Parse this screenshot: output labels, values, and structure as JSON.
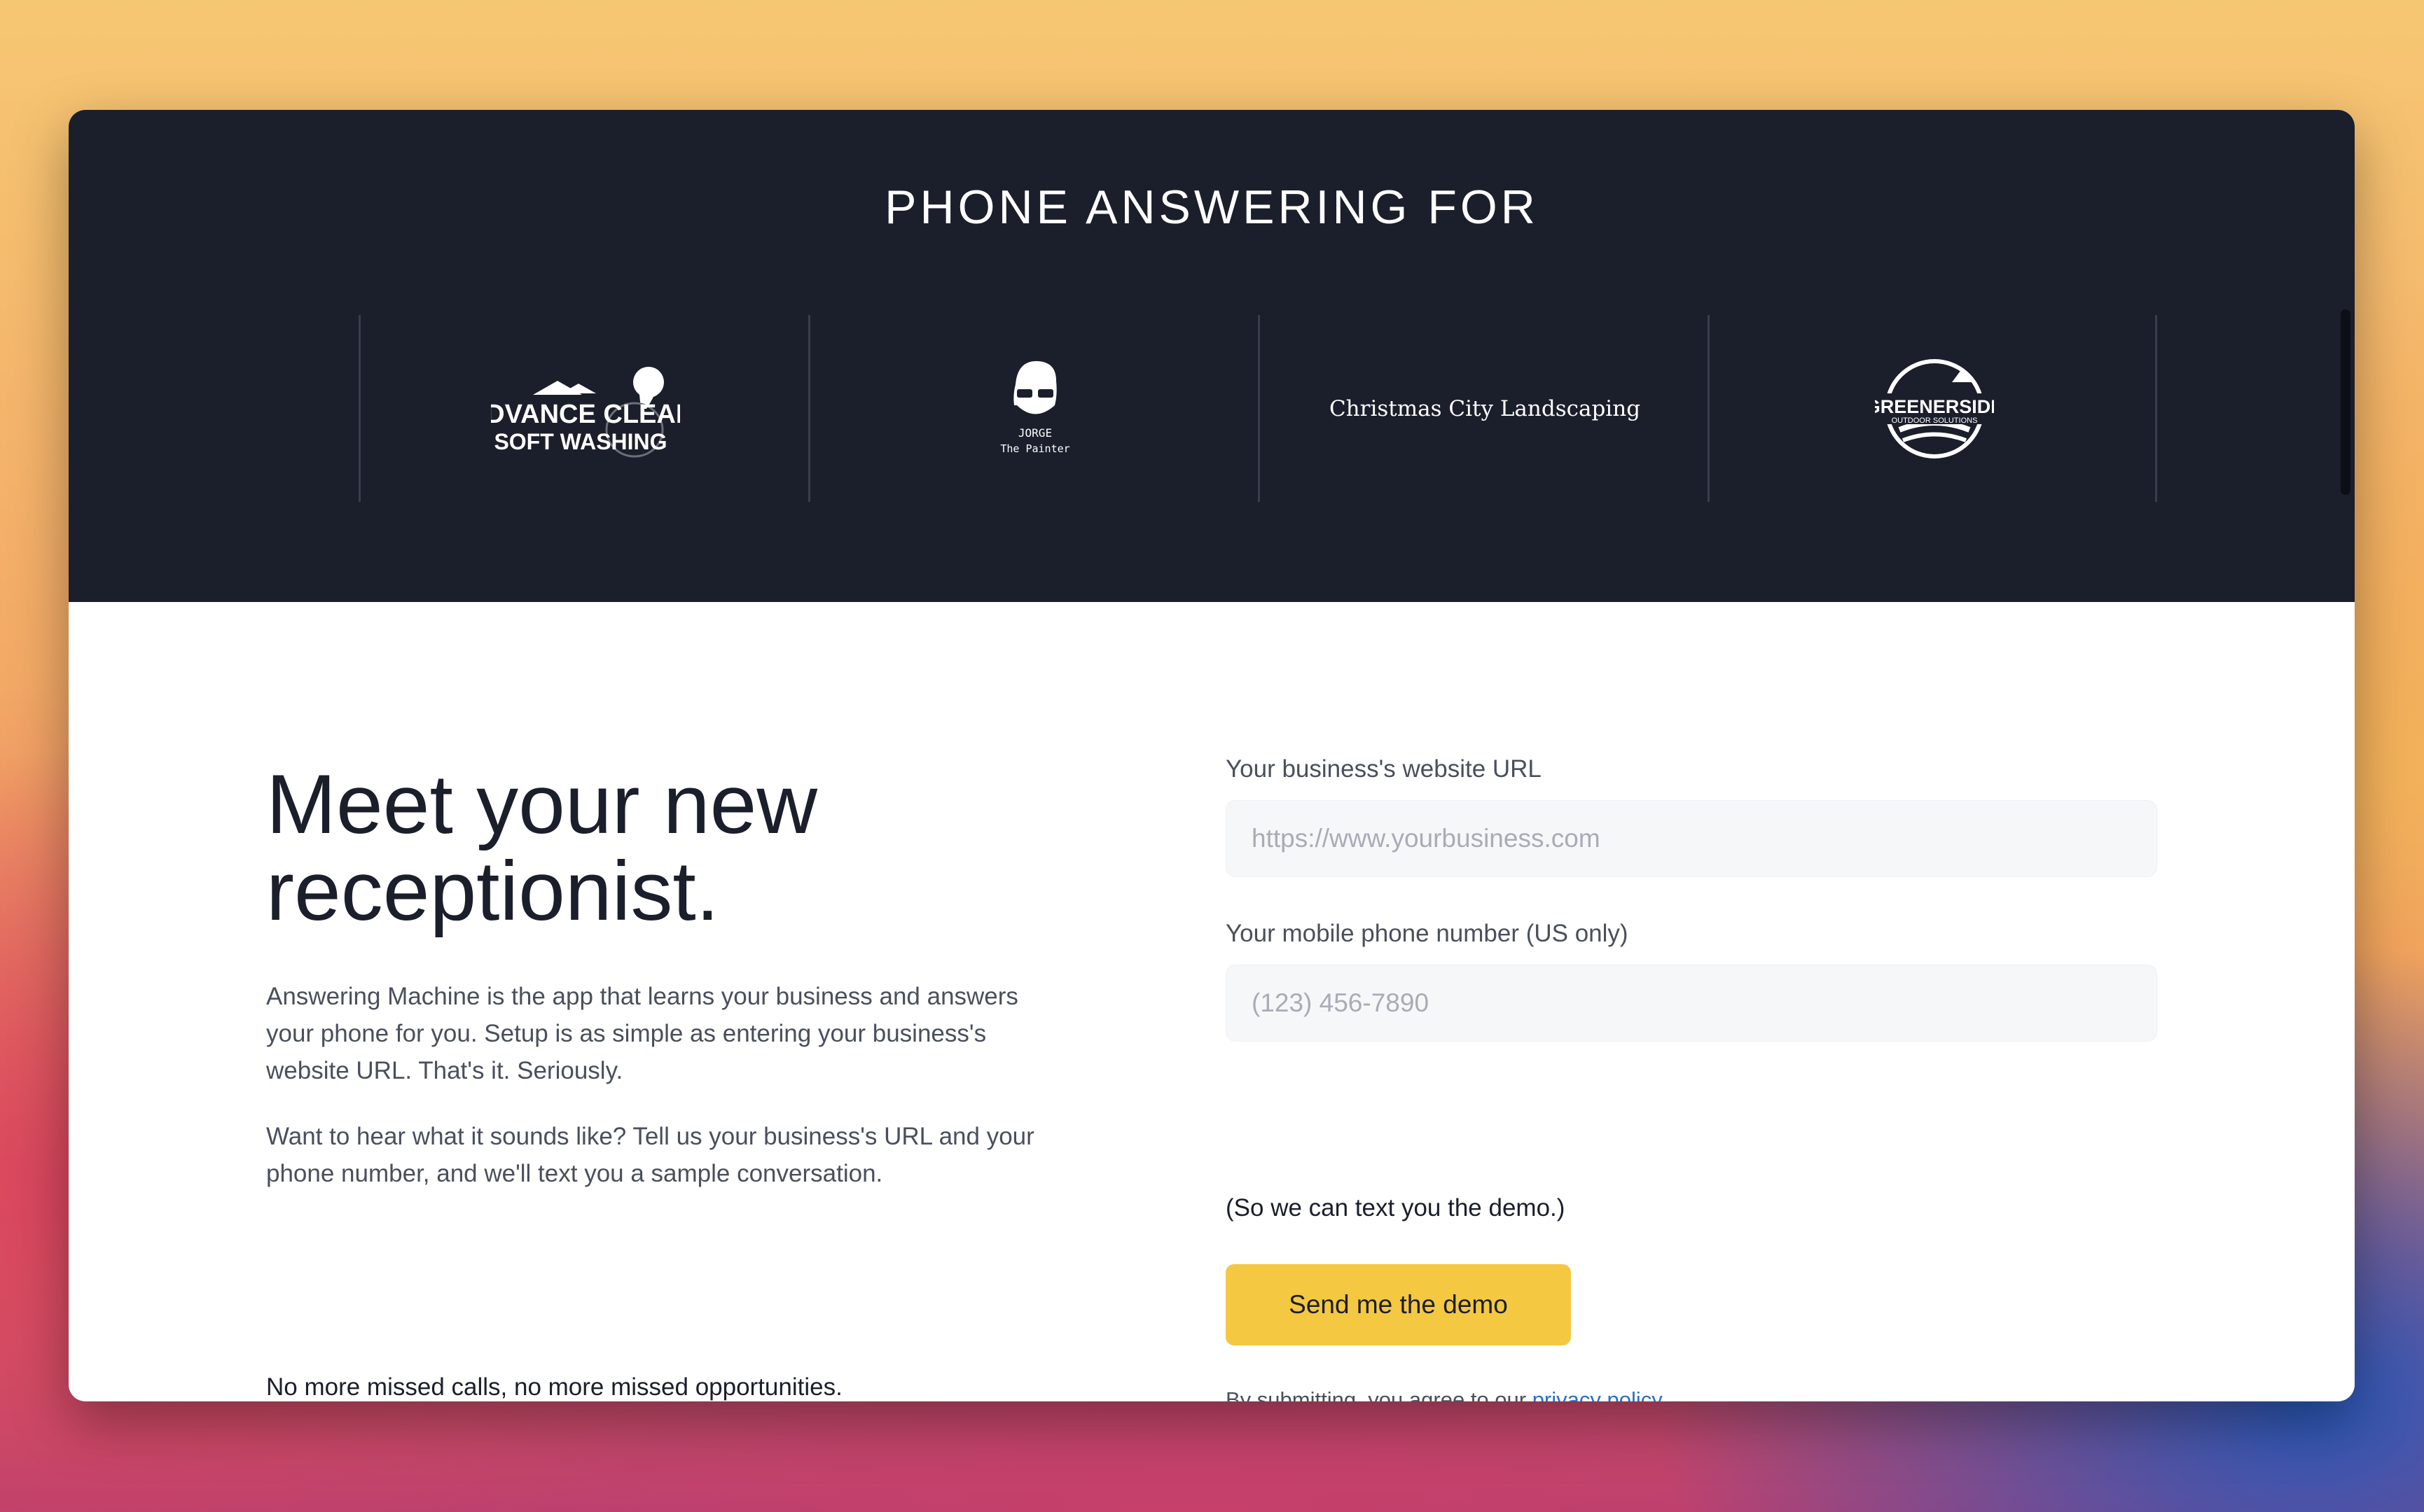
{
  "band": {
    "title": "PHONE ANSWERING FOR",
    "logos": [
      {
        "name": "advance-clean-logo",
        "line1": "ADVANCE CLEAN",
        "line2": "SOFT WASHING"
      },
      {
        "name": "jorge-the-painter-logo",
        "line1": "JORGE",
        "line2": "The Painter"
      },
      {
        "name": "christmas-city-landscaping-logo",
        "line1": "Christmas City Landscaping"
      },
      {
        "name": "greenerside-logo",
        "line1": "GREENERSIDE",
        "line2": "OUTDOOR SOLUTIONS"
      }
    ]
  },
  "hero": {
    "headline_line1": "Meet your new",
    "headline_line2": "receptionist.",
    "para1": "Answering Machine is the app that learns your business and answers your phone for you. Setup is as simple as entering your business's website URL. That's it. Seriously.",
    "para2": "Want to hear what it sounds like? Tell us your business's URL and your phone number, and we'll text you a sample conversation.",
    "tagline": "No more missed calls, no more missed opportunities."
  },
  "form": {
    "url_label": "Your business's website URL",
    "url_placeholder": "https://www.yourbusiness.com",
    "url_value": "",
    "phone_label": "Your mobile phone number (US only)",
    "phone_placeholder": "(123) 456-7890",
    "phone_value": "",
    "note": "(So we can text you the demo.)",
    "submit_label": "Send me the demo",
    "consent_prefix": "By submitting, you agree to our ",
    "consent_link": "privacy policy",
    "consent_suffix": "."
  },
  "colors": {
    "band_bg": "#1b1e2b",
    "accent_button": "#f5c842",
    "link": "#2e6fc2"
  }
}
